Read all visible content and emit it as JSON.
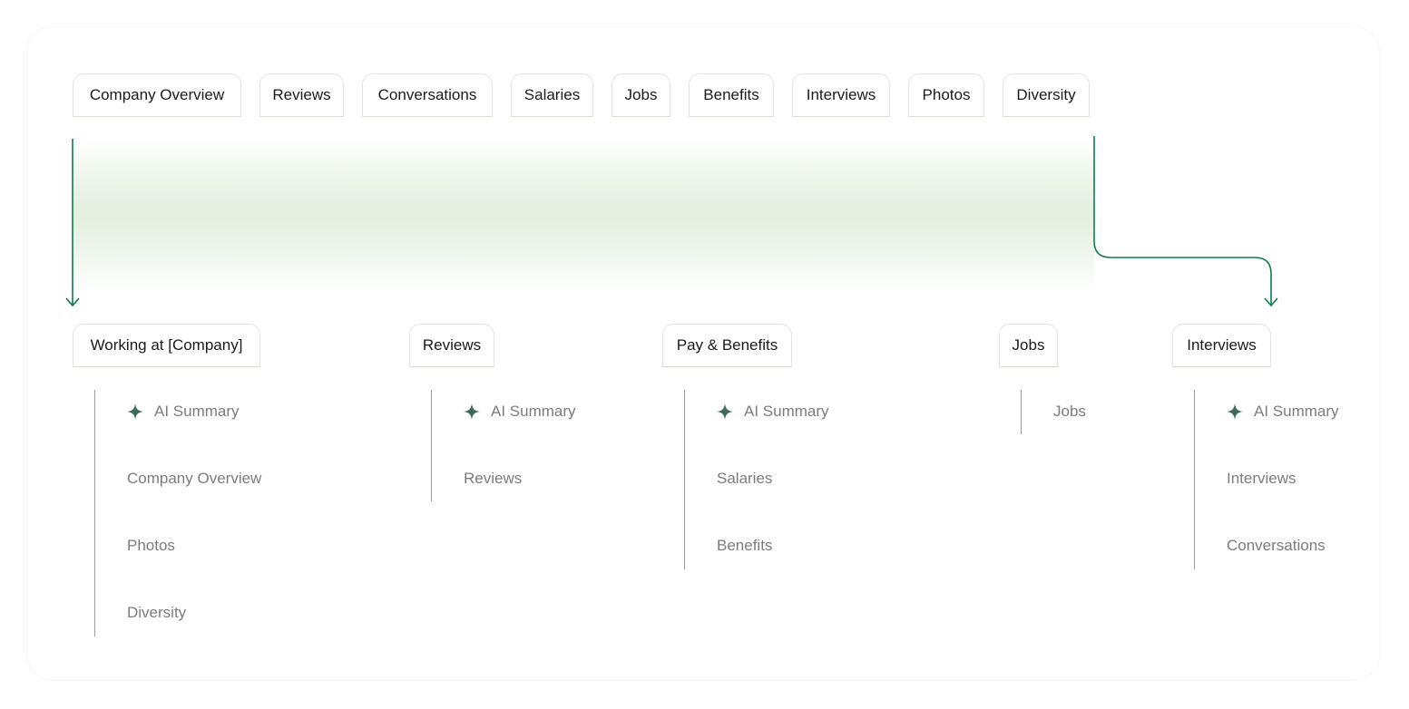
{
  "colors": {
    "accent_green": "#0d7d4d",
    "sparkle": "#3f6a5a",
    "band_green": "#e2efdd",
    "item_text": "#7c7c7c",
    "pill_text": "#1a1a1a",
    "divider": "#9a9a9a"
  },
  "top_tabs": [
    {
      "label": "Company Overview"
    },
    {
      "label": "Reviews"
    },
    {
      "label": "Conversations"
    },
    {
      "label": "Salaries"
    },
    {
      "label": "Jobs"
    },
    {
      "label": "Benefits"
    },
    {
      "label": "Interviews"
    },
    {
      "label": "Photos"
    },
    {
      "label": "Diversity"
    }
  ],
  "groups": [
    {
      "label": "Working at [Company]",
      "items": [
        {
          "label": "AI Summary",
          "icon": "sparkle-icon"
        },
        {
          "label": "Company Overview"
        },
        {
          "label": "Photos"
        },
        {
          "label": "Diversity"
        }
      ]
    },
    {
      "label": "Reviews",
      "items": [
        {
          "label": "AI Summary",
          "icon": "sparkle-icon"
        },
        {
          "label": "Reviews"
        }
      ]
    },
    {
      "label": "Pay & Benefits",
      "items": [
        {
          "label": "AI Summary",
          "icon": "sparkle-icon"
        },
        {
          "label": "Salaries"
        },
        {
          "label": "Benefits"
        }
      ]
    },
    {
      "label": "Jobs",
      "items": [
        {
          "label": "Jobs"
        }
      ]
    },
    {
      "label": "Interviews",
      "items": [
        {
          "label": "AI Summary",
          "icon": "sparkle-icon"
        },
        {
          "label": "Interviews"
        },
        {
          "label": "Conversations"
        }
      ]
    }
  ]
}
